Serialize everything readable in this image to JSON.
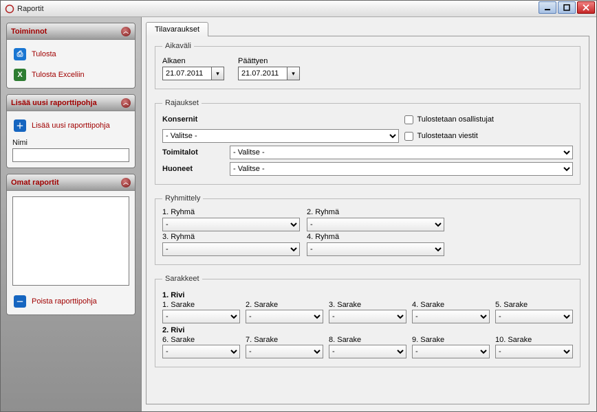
{
  "window": {
    "title": "Raportit"
  },
  "sidebar": {
    "toiminnot": {
      "title": "Toiminnot",
      "print": "Tulosta",
      "excel": "Tulosta Exceliin"
    },
    "lisaa": {
      "title": "Lisää uusi raporttipohja",
      "link": "Lisää uusi raporttipohja",
      "nimi_label": "Nimi",
      "nimi_value": ""
    },
    "omat": {
      "title": "Omat raportit",
      "poista": "Poista raporttipohja"
    }
  },
  "tabs": {
    "tilavaraukset": "Tilavaraukset"
  },
  "aikavali": {
    "legend": "Aikaväli",
    "alkaen_label": "Alkaen",
    "alkaen_value": "21.07.2011",
    "paattyy_label": "Päättyen",
    "paattyy_value": "21.07.2011"
  },
  "rajaukset": {
    "legend": "Rajaukset",
    "konsernit_label": "Konsernit",
    "konsernit_value": "- Valitse -",
    "toimitalot_label": "Toimitalot",
    "toimitalot_value": "- Valitse -",
    "huoneet_label": "Huoneet",
    "huoneet_value": "- Valitse -",
    "chk_osallistujat": "Tulostetaan osallistujat",
    "chk_viestit": "Tulostetaan viestit"
  },
  "ryhmittely": {
    "legend": "Ryhmittely",
    "r1": "1. Ryhmä",
    "r2": "2. Ryhmä",
    "r3": "3. Ryhmä",
    "r4": "4. Ryhmä",
    "dash": "-"
  },
  "sarakkeet": {
    "legend": "Sarakkeet",
    "rivi1": "1. Rivi",
    "rivi2": "2. Rivi",
    "s1": "1. Sarake",
    "s2": "2. Sarake",
    "s3": "3. Sarake",
    "s4": "4. Sarake",
    "s5": "5. Sarake",
    "s6": "6. Sarake",
    "s7": "7. Sarake",
    "s8": "8. Sarake",
    "s9": "9. Sarake",
    "s10": "10. Sarake",
    "dash": "-"
  }
}
